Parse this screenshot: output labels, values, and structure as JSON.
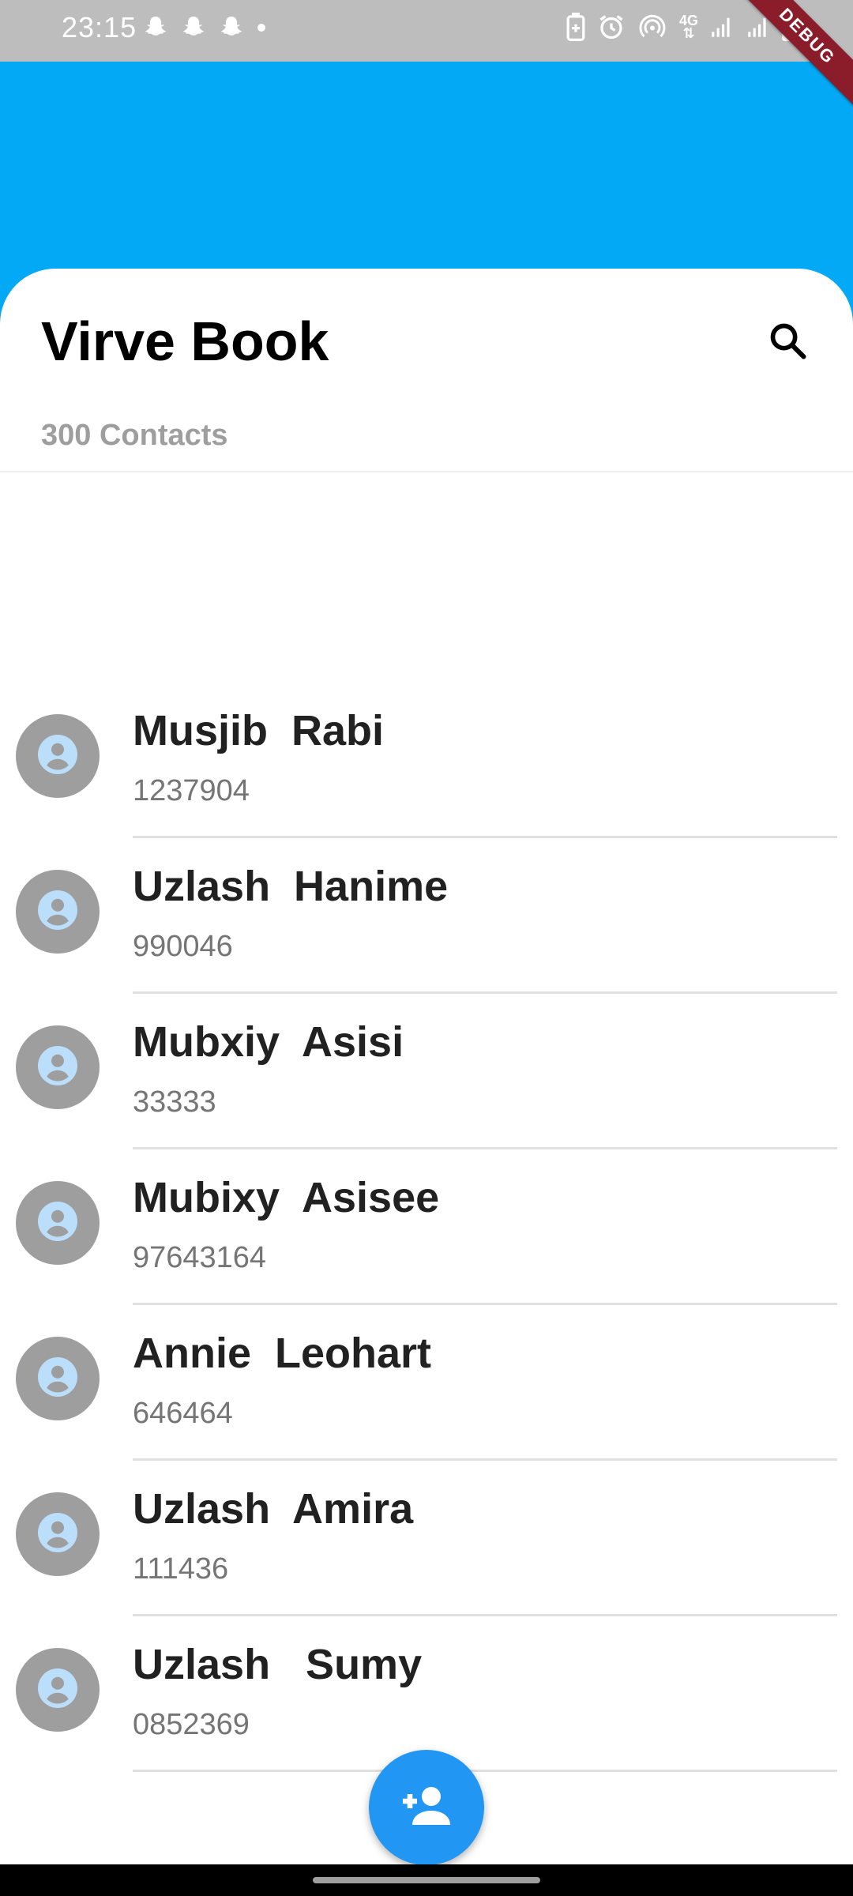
{
  "status_bar": {
    "time": "23:15",
    "icons_left": [
      "snapchat-icon",
      "snapchat-icon",
      "snapchat-icon",
      "dot-icon"
    ],
    "icons_right": [
      "battery-saver-icon",
      "alarm-icon",
      "hotspot-icon",
      "network-4g-icon",
      "signal-icon",
      "signal-icon",
      "battery-icon"
    ],
    "network_label": "4G"
  },
  "debug_banner": "DEBUG",
  "header": {
    "title": "Virve Book",
    "count_label": "300 Contacts",
    "search_icon": "search-icon"
  },
  "contacts": [
    {
      "name": "Musjib  Rabi",
      "phone": "1237904"
    },
    {
      "name": "Uzlash  Hanime",
      "phone": "990046"
    },
    {
      "name": "Mubxiy  Asisi",
      "phone": "33333"
    },
    {
      "name": "Mubixy  Asisee",
      "phone": "97643164"
    },
    {
      "name": "Annie  Leohart",
      "phone": "646464"
    },
    {
      "name": "Uzlash  Amira",
      "phone": "111436"
    },
    {
      "name": "Uzlash   Sumy",
      "phone": "0852369"
    }
  ],
  "fab": {
    "icon": "person-add-icon"
  },
  "colors": {
    "app_bar": "#03a9f4",
    "fab": "#2196f3",
    "avatar_bg": "#9e9e9e",
    "avatar_icon": "#bbdefb",
    "status_bar": "#bdbdbd",
    "debug_banner": "#8b1c2a"
  }
}
